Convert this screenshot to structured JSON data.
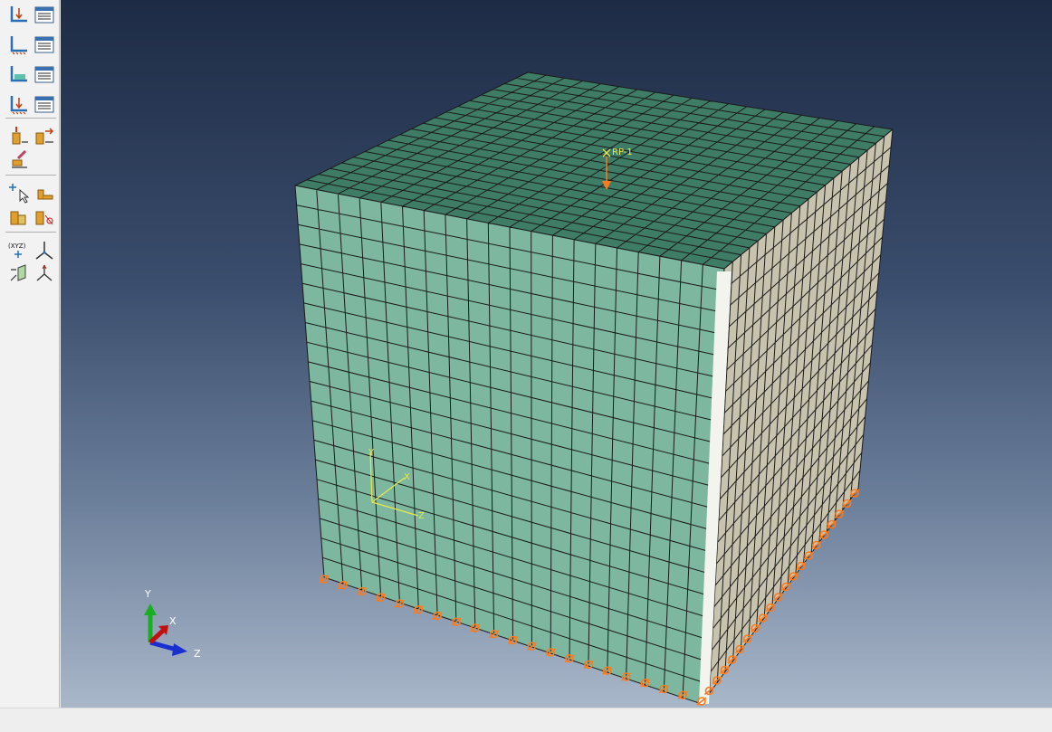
{
  "viewport": {
    "reference_point_label": "RP-1",
    "local_csys": {
      "x": "X",
      "y": "Y",
      "z": "Z"
    },
    "triad": {
      "x": "X",
      "y": "Y",
      "z": "Z"
    },
    "mesh_divisions": 20,
    "colors": {
      "top_face": "#3f7c66",
      "front_face": "#7db7a0",
      "side_face": "#c7c3ae",
      "mesh_lines": "#1a1a1a",
      "boundary_condition": "#ff7a1a",
      "annotation": "#e8e84a"
    }
  },
  "toolbox": {
    "groups": [
      [
        "load-manager-icon",
        "load-table-icon",
        "bc-manager-icon",
        "bc-table-icon",
        "predefined-field-icon",
        "predefined-table-icon",
        "load-case-icon",
        "load-case-table-icon"
      ],
      [
        "create-load-icon",
        "create-bc-icon",
        "create-field-icon"
      ],
      [
        "select-icon",
        "create-special-icon",
        "create-tool-icon",
        "partition-icon"
      ],
      [
        "datum-point-icon",
        "datum-axis-icon",
        "datum-plane-icon",
        "datum-csys-icon"
      ]
    ]
  }
}
